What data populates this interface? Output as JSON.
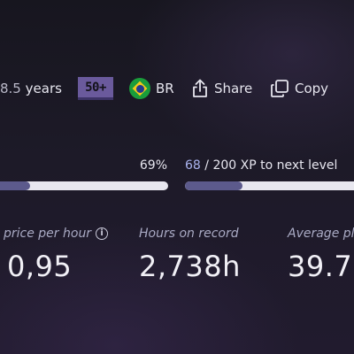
{
  "profile_meta": {
    "years_value": "8.5",
    "years_unit": "years",
    "age_badge": "50+",
    "country_code": "BR",
    "share_label": "Share",
    "copy_label": "Copy"
  },
  "progress": {
    "completion_label": "69%",
    "completion_fraction": 0.21,
    "xp_current": "68",
    "xp_rest": "/ 200 XP to next level",
    "xp_fraction": 0.34
  },
  "stats": [
    {
      "label": "price per hour",
      "value": "0,95"
    },
    {
      "label": "Hours on record",
      "value": "2,738h"
    },
    {
      "label": "Average pla",
      "value": "39.7"
    }
  ],
  "colors": {
    "accent": "#5c5a8c",
    "track": "#e8e7ef",
    "badge": "#6a5a9c"
  }
}
